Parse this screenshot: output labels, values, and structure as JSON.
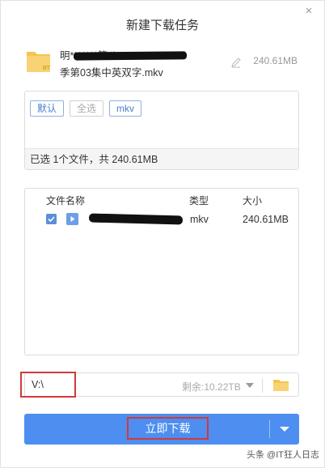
{
  "dialog": {
    "title": "新建下载任务",
    "close_label": "×"
  },
  "file": {
    "name_line1": "明*******第八",
    "name_line2": "季第03集中英双字.mkv",
    "size": "240.61MB",
    "badge": "BT"
  },
  "filter": {
    "chips": [
      "默认",
      "全选",
      "mkv"
    ],
    "summary": "已选 1个文件，共 240.61MB"
  },
  "list": {
    "headers": {
      "name": "文件名称",
      "type": "类型",
      "size": "大小"
    },
    "rows": [
      {
        "type": "mkv",
        "size": "240.61MB",
        "checked": true
      }
    ]
  },
  "path": {
    "value": "V:\\",
    "space_left": "剩余:10.22TB"
  },
  "download": {
    "label": "立即下载"
  },
  "watermark": {
    "text": "头条 @IT狂人日志"
  },
  "colors": {
    "accent": "#4d8ef0",
    "highlight": "#d23a3a",
    "folder": "#f5c451"
  }
}
